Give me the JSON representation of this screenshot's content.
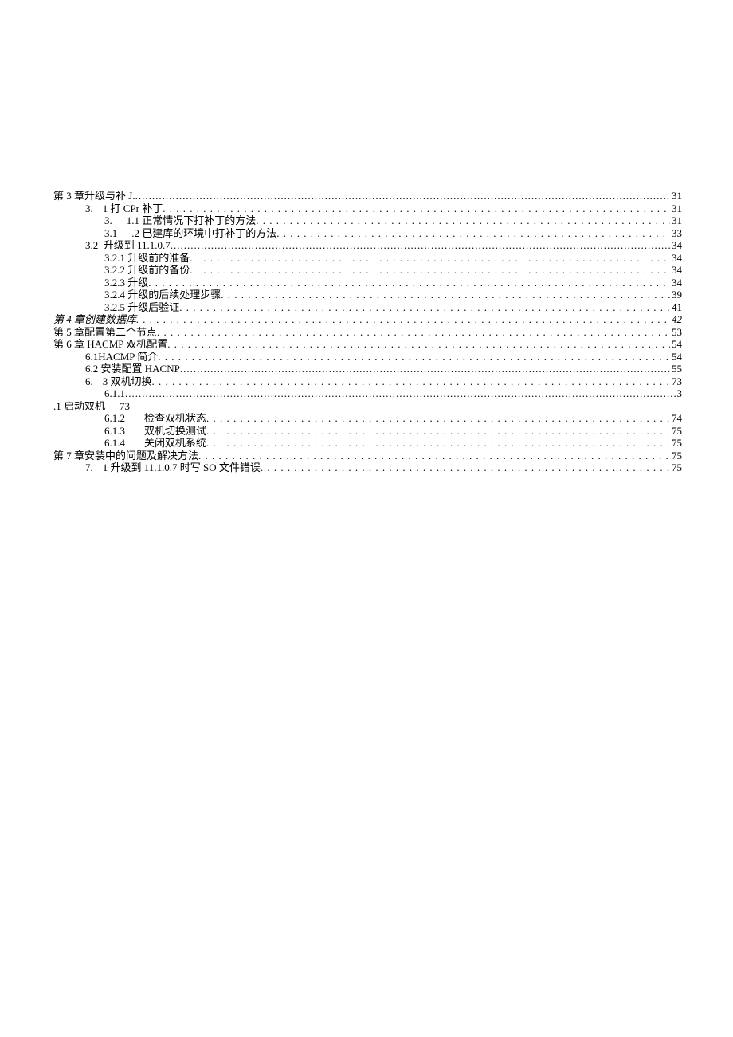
{
  "toc": {
    "e0": {
      "label": "第 3 章升级与补 J.",
      "page": "31"
    },
    "e1": {
      "prefix": "3.",
      "label": "1 打 CPr 补丁",
      "page": "31"
    },
    "e2": {
      "prefix": "3.",
      "label": "1.1 正常情况下打补丁的方法",
      "page": "31"
    },
    "e3": {
      "prefix": "3.1",
      "label": ".2 已建库的环境中打补丁的方法",
      "page": "33"
    },
    "e4": {
      "prefix": "3.2",
      "label": "升级到 11.1.0.7",
      "page": "34"
    },
    "e5": {
      "label": "3.2.1 升级前的准备",
      "page": "34"
    },
    "e6": {
      "label": "3.2.2 升级前的备份",
      "page": "34"
    },
    "e7": {
      "label": "3.2.3 升级",
      "page": "34"
    },
    "e8": {
      "label": "3.2.4 升级的后续处理步骤",
      "page": "39"
    },
    "e9": {
      "label": "3.2.5 升级后验证",
      "page": "41"
    },
    "e10": {
      "label": "第 4 章创建数据库",
      "page": "42"
    },
    "e11": {
      "label": "第 5 章配置第二个节点",
      "page": "53"
    },
    "e12": {
      "label": "第 6 章 HACMP 双机配置",
      "page": "54"
    },
    "e13": {
      "label": "6.1HACMP 简介",
      "page": "54"
    },
    "e14": {
      "label": "6.2 安装配置 HACNP",
      "page": "55"
    },
    "e15": {
      "prefix": "6.",
      "label": "3 双机切换",
      "page": "73"
    },
    "e16": {
      "label": "6.1.1",
      "page": "3"
    },
    "e17": {
      "label": ".1 启动双机",
      "page": "73"
    },
    "e18": {
      "prefix": "6.1.2",
      "label": "检查双机状态",
      "page": "74"
    },
    "e19": {
      "prefix": "6.1.3",
      "label": "双机切换测试",
      "page": "75"
    },
    "e20": {
      "prefix": "6.1.4",
      "label": "关闭双机系统",
      "page": "75"
    },
    "e21": {
      "label": "第 7 章安装中的问题及解决方法",
      "page": "75"
    },
    "e22": {
      "prefix": "7.",
      "label": "1 升级到 11.1.0.7 时写 SO 文件错误",
      "page": "75"
    }
  }
}
